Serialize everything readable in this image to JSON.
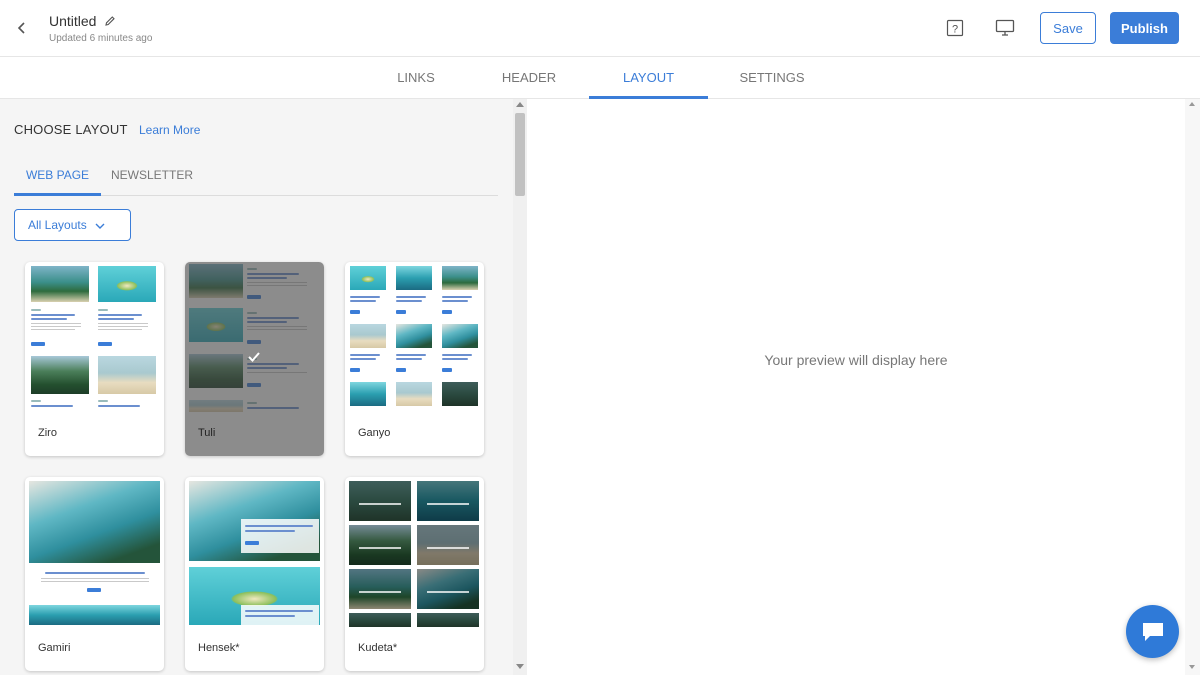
{
  "header": {
    "title": "Untitled",
    "updated": "Updated 6 minutes ago",
    "save_label": "Save",
    "publish_label": "Publish"
  },
  "main_tabs": [
    {
      "label": "LINKS"
    },
    {
      "label": "HEADER"
    },
    {
      "label": "LAYOUT",
      "active": true
    },
    {
      "label": "SETTINGS"
    }
  ],
  "layout_panel": {
    "heading": "CHOOSE LAYOUT",
    "learn_more": "Learn More",
    "sub_tabs": [
      {
        "label": "WEB PAGE",
        "active": true
      },
      {
        "label": "NEWSLETTER"
      }
    ],
    "filter": "All Layouts",
    "layouts": [
      {
        "name": "Ziro",
        "selected": false
      },
      {
        "name": "Tuli",
        "selected": true
      },
      {
        "name": "Ganyo",
        "selected": false
      },
      {
        "name": "Gamiri",
        "selected": false
      },
      {
        "name": "Hensek*",
        "selected": false
      },
      {
        "name": "Kudeta*",
        "selected": false
      }
    ]
  },
  "preview": {
    "placeholder": "Your preview will display here"
  },
  "colors": {
    "accent": "#3b7dd8",
    "panel_bg": "#f5f5f5"
  },
  "icons": [
    "back-arrow-icon",
    "pencil-icon",
    "help-icon",
    "monitor-icon",
    "chevron-down-icon",
    "checkmark-icon",
    "chat-bubble-icon"
  ]
}
